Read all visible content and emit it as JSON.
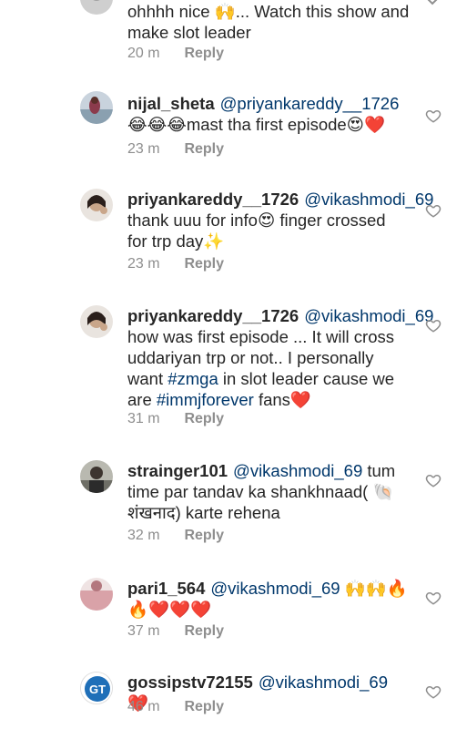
{
  "comments": [
    {
      "user": "",
      "segments": [
        {
          "t": "text",
          "v": "ohhhh nice 🙌... Watch this show and make slot leader"
        }
      ],
      "time": "20 m",
      "reply": "Reply"
    },
    {
      "user": "nijal_sheta",
      "segments": [
        {
          "t": "mention",
          "v": "@priyankareddy__1726"
        },
        {
          "t": "text",
          "v": " 😂😂😂mast tha first episode😍❤️"
        }
      ],
      "time": "23 m",
      "reply": "Reply"
    },
    {
      "user": "priyankareddy__1726",
      "segments": [
        {
          "t": "mention",
          "v": "@vikashmodi_69"
        },
        {
          "t": "text",
          "v": " thank uuu for info😍 finger crossed for trp day✨"
        }
      ],
      "time": "23 m",
      "reply": "Reply"
    },
    {
      "user": "priyankareddy__1726",
      "segments": [
        {
          "t": "mention",
          "v": "@vikashmodi_69"
        },
        {
          "t": "text",
          "v": " how was first episode ... It will cross uddariyan trp or not.. I personally want "
        },
        {
          "t": "tag",
          "v": "#zmga"
        },
        {
          "t": "text",
          "v": " in slot leader cause we are "
        },
        {
          "t": "tag",
          "v": "#immjforever"
        },
        {
          "t": "text",
          "v": " fans❤️"
        }
      ],
      "time": "31 m",
      "reply": "Reply"
    },
    {
      "user": "strainger101",
      "segments": [
        {
          "t": "mention",
          "v": "@vikashmodi_69"
        },
        {
          "t": "text",
          "v": " tum time par tandav ka shankhnaad( 🐚 शंखनाद) karte rehena"
        }
      ],
      "time": "32 m",
      "reply": "Reply"
    },
    {
      "user": "pari1_564",
      "segments": [
        {
          "t": "mention",
          "v": "@vikashmodi_69"
        },
        {
          "t": "text",
          "v": " 🙌🙌🔥🔥❤️❤️❤️"
        }
      ],
      "time": "37 m",
      "reply": "Reply"
    },
    {
      "user": "gossipstv72155",
      "segments": [
        {
          "t": "mention",
          "v": "@vikashmodi_69"
        },
        {
          "t": "text",
          "v": " ❤️"
        }
      ],
      "time": "46 m",
      "reply": "Reply"
    }
  ],
  "avatars": [
    "",
    "nijal_sheta",
    "priyankareddy__1726",
    "priyankareddy__1726",
    "strainger101",
    "pari1_564",
    "gossipstv72155"
  ],
  "avatar_badge_text": "GT",
  "colors": {
    "text": "#262626",
    "link": "#00376b",
    "meta": "#8e8e8e",
    "heart_outline": "#8e8e8e"
  },
  "icons": [
    "like-heart-icon",
    "chevron-down-icon"
  ]
}
